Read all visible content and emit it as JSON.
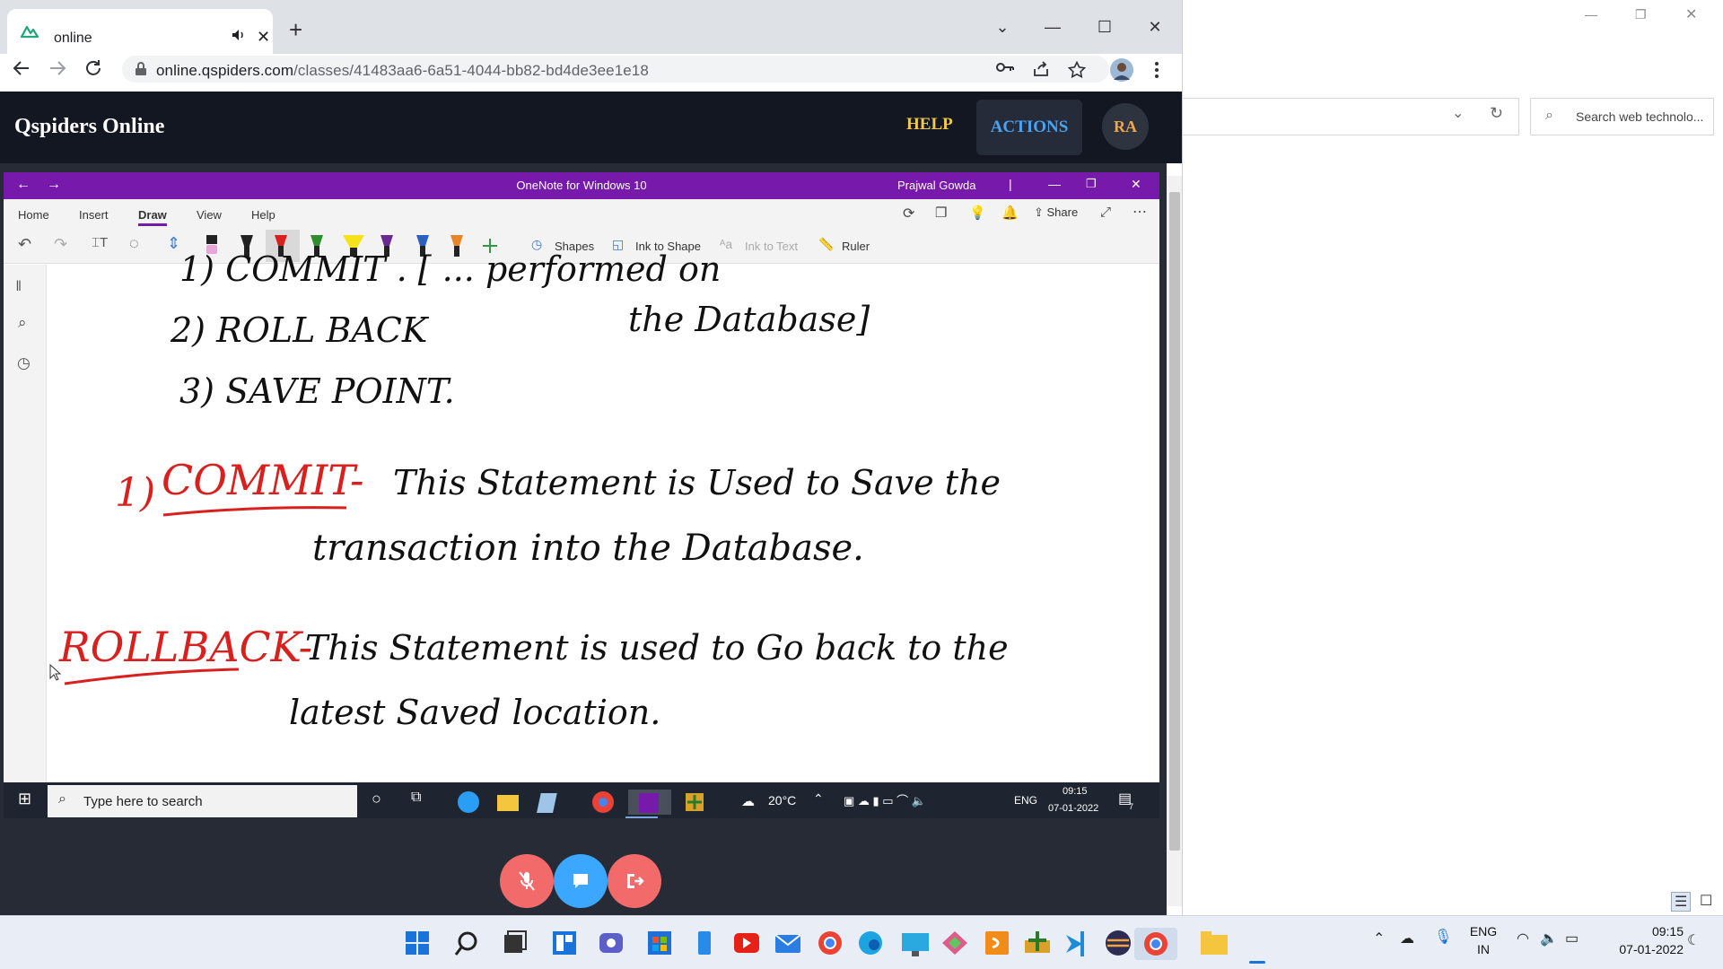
{
  "browser": {
    "tab_title": "online",
    "url_host": "online.qspiders.com",
    "url_path": "/classes/41483aa6-6a51-4044-bb82-bd4de3ee1e18"
  },
  "site": {
    "brand": "Qspiders Online",
    "help": "HELP",
    "actions": "ACTIONS",
    "avatar_initials": "RA"
  },
  "onenote": {
    "window_title": "OneNote for Windows 10",
    "user": "Prajwal Gowda",
    "menu": [
      "Home",
      "Insert",
      "Draw",
      "View",
      "Help"
    ],
    "active_menu": "Draw",
    "share": "Share",
    "tools": {
      "shapes": "Shapes",
      "ink_to_shape": "Ink to Shape",
      "ink_to_text": "Ink to Text",
      "ruler": "Ruler"
    },
    "notes": {
      "line1": "1) COMMIT .  [ ... performed on",
      "line2": "2) ROLL BACK",
      "line2b": "the Database]",
      "line3": "3) SAVE POINT.",
      "commit_num": "1)",
      "commit_label": "COMMIT-",
      "commit_text1": "This Statement is Used to Save the",
      "commit_text2": "transaction into the Database.",
      "rollback_label": "ROLLBACK-",
      "rollback_text1": "This Statement is used to Go back to the",
      "rollback_text2": "latest Saved location."
    }
  },
  "inner_taskbar": {
    "search_placeholder": "Type here to search",
    "weather": "20°C",
    "lang": "ENG",
    "time": "09:15",
    "date": "07-01-2022",
    "notif_count": "7"
  },
  "right_window": {
    "search_placeholder": "Search web technolo..."
  },
  "taskbar": {
    "lang_top": "ENG",
    "lang_bottom": "IN",
    "time": "09:15",
    "date": "07-01-2022"
  },
  "colors": {
    "onenote_purple": "#7719aa",
    "qs_header": "#131722",
    "help_yellow": "#f2c84b",
    "actions_blue": "#4aa3f0",
    "call_red": "#f26a6a",
    "call_blue": "#3ba7ff",
    "ink_red": "#d8201e"
  }
}
